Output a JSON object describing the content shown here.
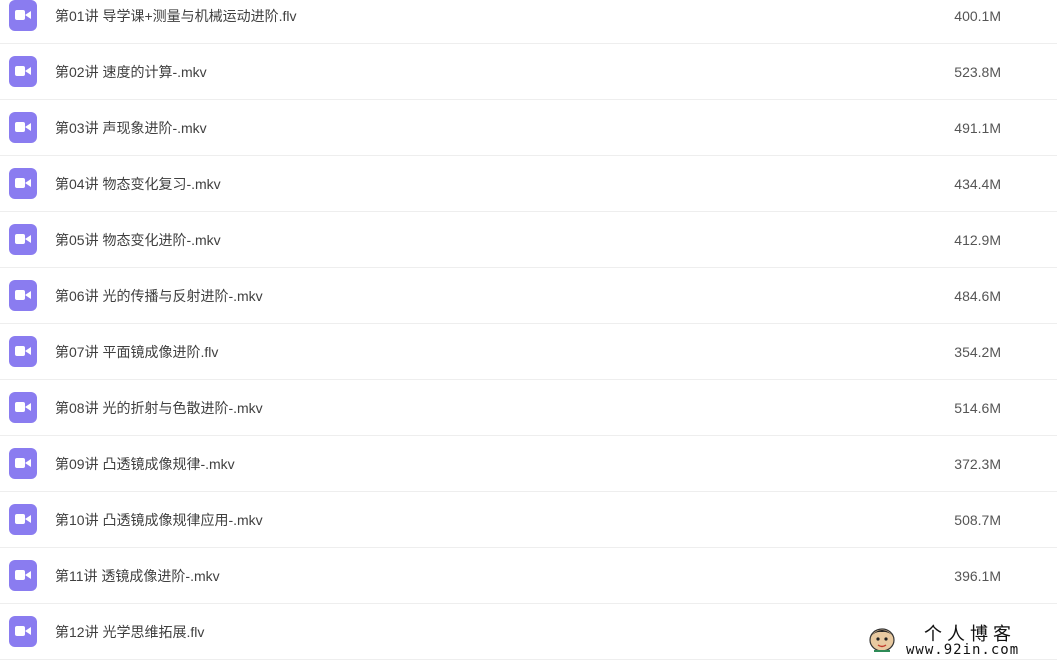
{
  "files": [
    {
      "name": "第01讲 导学课+测量与机械运动进阶.flv",
      "size": "400.1M",
      "icon": "video-file-icon"
    },
    {
      "name": "第02讲 速度的计算-.mkv",
      "size": "523.8M",
      "icon": "video-file-icon"
    },
    {
      "name": "第03讲 声现象进阶-.mkv",
      "size": "491.1M",
      "icon": "video-file-icon"
    },
    {
      "name": "第04讲 物态变化复习-.mkv",
      "size": "434.4M",
      "icon": "video-file-icon"
    },
    {
      "name": "第05讲 物态变化进阶-.mkv",
      "size": "412.9M",
      "icon": "video-file-icon"
    },
    {
      "name": "第06讲 光的传播与反射进阶-.mkv",
      "size": "484.6M",
      "icon": "video-file-icon"
    },
    {
      "name": "第07讲 平面镜成像进阶.flv",
      "size": "354.2M",
      "icon": "video-file-icon"
    },
    {
      "name": "第08讲 光的折射与色散进阶-.mkv",
      "size": "514.6M",
      "icon": "video-file-icon"
    },
    {
      "name": "第09讲 凸透镜成像规律-.mkv",
      "size": "372.3M",
      "icon": "video-file-icon"
    },
    {
      "name": "第10讲 凸透镜成像规律应用-.mkv",
      "size": "508.7M",
      "icon": "video-file-icon"
    },
    {
      "name": "第11讲 透镜成像进阶-.mkv",
      "size": "396.1M",
      "icon": "video-file-icon"
    },
    {
      "name": "第12讲 光学思维拓展.flv",
      "size": "",
      "icon": "video-file-icon"
    }
  ],
  "watermark": {
    "title": "个人博客",
    "url": "www.92in.com"
  },
  "colors": {
    "icon_bg": "#8a7cf0",
    "divider": "#eeeeee",
    "text": "#404040"
  }
}
